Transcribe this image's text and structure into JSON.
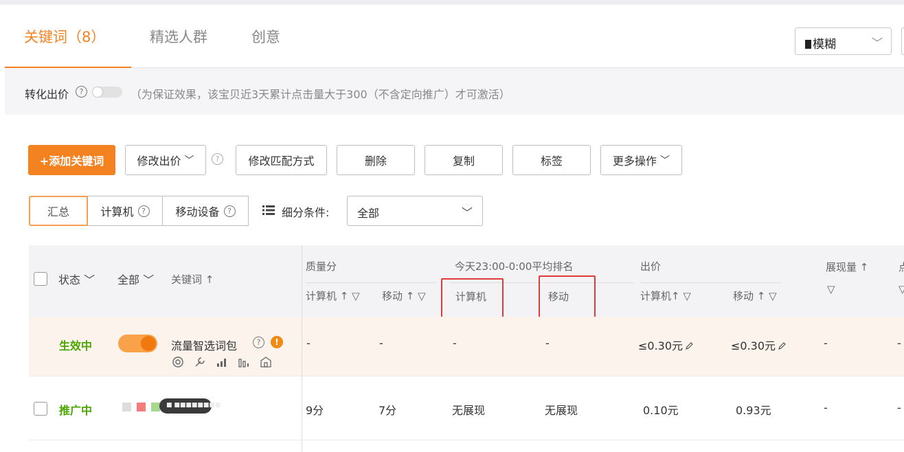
{
  "tabs": [
    {
      "label": "关键词（8）",
      "active": true
    },
    {
      "label": "精选人群",
      "active": false
    },
    {
      "label": "创意",
      "active": false
    }
  ],
  "top_select": {
    "value": "模糊"
  },
  "bid_bar": {
    "label": "转化出价",
    "help": "?",
    "note": "（为保证效果，该宝贝近3天累计点击量大于300（不含定向推广）才可激活）"
  },
  "toolbar": {
    "add_keyword": "+添加关键词",
    "modify_bid": "修改出价",
    "help": "?",
    "modify_match": "修改匹配方式",
    "delete": "删除",
    "copy": "复制",
    "tag": "标签",
    "more": "更多操作"
  },
  "device_tabs": {
    "summary": "汇总",
    "computer": "计算机",
    "mobile": "移动设备",
    "help": "?"
  },
  "filter": {
    "label": "细分条件:",
    "value": "全部"
  },
  "table_header": {
    "status": "状态",
    "all": "全部",
    "keyword": "关键词 ↑",
    "quality_score": "质量分",
    "qs_computer": "计算机 ↑",
    "qs_mobile": "移动 ↑",
    "rank_title": "今天23:00-0:00平均排名",
    "rank_computer": "计算机",
    "rank_mobile": "移动",
    "bid": "出价",
    "bid_computer": "计算机↑",
    "bid_mobile": "移动 ↑",
    "impressions": "展现量 ↑",
    "next_col": "点"
  },
  "rows": [
    {
      "status": "生效中",
      "keyword": "流量智选词包",
      "info": "!",
      "help": "?",
      "qs_computer": "-",
      "qs_mobile": "-",
      "rank_computer": "-",
      "rank_mobile": "-",
      "bid_computer": "≤0.30元",
      "bid_mobile": "≤0.30元",
      "impressions": "-",
      "next_col": "-"
    },
    {
      "status": "推广中",
      "keyword_tooltip": "■ ■■■■■■■■",
      "qs_computer": "9分",
      "qs_mobile": "7分",
      "rank_computer": "无展现",
      "rank_mobile": "无展现",
      "bid_computer": "0.10元",
      "bid_mobile": "0.93元",
      "impressions": "-",
      "next_col": "-"
    }
  ],
  "colors": {
    "accent": "#f58220",
    "status_green": "#4aa600",
    "highlight_box": "#e13a3a",
    "row_highlight": "#fbf3ec",
    "swatches": [
      "#dcdcdc",
      "#f47c7c",
      "#a7d88f"
    ]
  }
}
